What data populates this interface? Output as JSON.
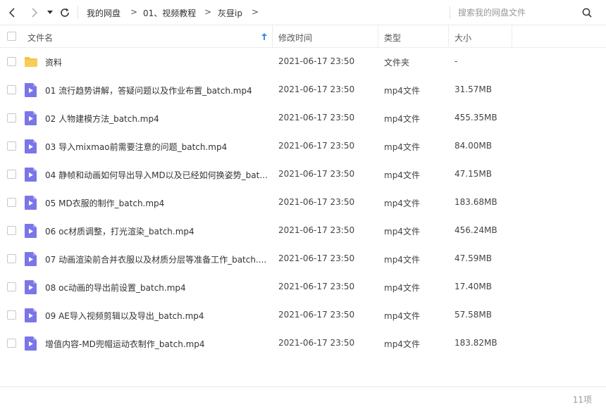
{
  "breadcrumb": {
    "items": [
      "我的网盘",
      "01、视频教程",
      "灰昼ip"
    ],
    "separator": ">"
  },
  "search": {
    "placeholder": "搜索我的网盘文件"
  },
  "columns": {
    "name": "文件名",
    "modified": "修改时间",
    "type": "类型",
    "size": "大小"
  },
  "files": [
    {
      "name": "资料",
      "modified": "2021-06-17 23:50",
      "type": "文件夹",
      "size": "-",
      "icon": "folder-icon"
    },
    {
      "name": "01 流行趋势讲解，答疑问题以及作业布置_batch.mp4",
      "modified": "2021-06-17 23:50",
      "type": "mp4文件",
      "size": "31.57MB",
      "icon": "video-file-icon"
    },
    {
      "name": "02 人物建模方法_batch.mp4",
      "modified": "2021-06-17 23:50",
      "type": "mp4文件",
      "size": "455.35MB",
      "icon": "video-file-icon"
    },
    {
      "name": "03 导入mixmao前需要注意的问题_batch.mp4",
      "modified": "2021-06-17 23:50",
      "type": "mp4文件",
      "size": "84.00MB",
      "icon": "video-file-icon"
    },
    {
      "name": "04 静帧和动画如何导出导入MD以及已经如何换姿势_bat...",
      "modified": "2021-06-17 23:50",
      "type": "mp4文件",
      "size": "47.15MB",
      "icon": "video-file-icon"
    },
    {
      "name": "05 MD衣服的制作_batch.mp4",
      "modified": "2021-06-17 23:50",
      "type": "mp4文件",
      "size": "183.68MB",
      "icon": "video-file-icon"
    },
    {
      "name": "06 oc材质调整，打光渲染_batch.mp4",
      "modified": "2021-06-17 23:50",
      "type": "mp4文件",
      "size": "456.24MB",
      "icon": "video-file-icon"
    },
    {
      "name": "07 动画渲染前合并衣服以及材质分层等准备工作_batch....",
      "modified": "2021-06-17 23:50",
      "type": "mp4文件",
      "size": "47.59MB",
      "icon": "video-file-icon"
    },
    {
      "name": "08 oc动画的导出前设置_batch.mp4",
      "modified": "2021-06-17 23:50",
      "type": "mp4文件",
      "size": "17.40MB",
      "icon": "video-file-icon"
    },
    {
      "name": "09 AE导入视频剪辑以及导出_batch.mp4",
      "modified": "2021-06-17 23:50",
      "type": "mp4文件",
      "size": "57.58MB",
      "icon": "video-file-icon"
    },
    {
      "name": "增值内容-MD兜帽运动衣制作_batch.mp4",
      "modified": "2021-06-17 23:50",
      "type": "mp4文件",
      "size": "183.82MB",
      "icon": "video-file-icon"
    }
  ],
  "footer": {
    "count": "11项"
  },
  "colors": {
    "folder": "#f5c143",
    "video": "#7b76e8",
    "sort_arrow": "#3b8ee8"
  }
}
